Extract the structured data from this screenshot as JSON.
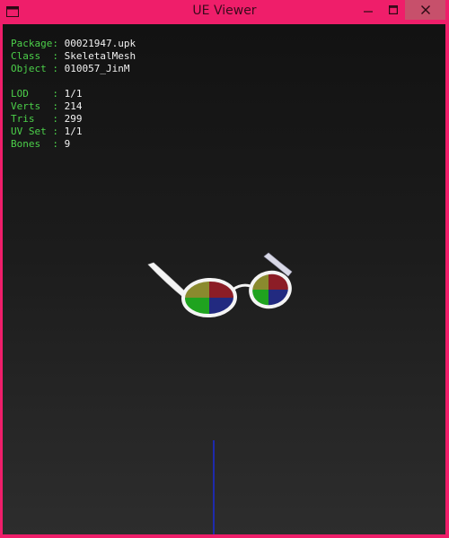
{
  "window": {
    "title": "UE Viewer",
    "minimize_glyph": "—",
    "maximize_glyph": "☐",
    "close_glyph": "✕"
  },
  "info": {
    "group1": [
      {
        "label": "Package:",
        "value": "00021947.upk"
      },
      {
        "label": "Class  :",
        "value": "SkeletalMesh"
      },
      {
        "label": "Object :",
        "value": "010057_JinM"
      }
    ],
    "group2": [
      {
        "label": "LOD    :",
        "value": "1/1"
      },
      {
        "label": "Verts  :",
        "value": "214"
      },
      {
        "label": "Tris   :",
        "value": "299"
      },
      {
        "label": "UV Set :",
        "value": "1/1"
      },
      {
        "label": "Bones  :",
        "value": "9"
      }
    ]
  },
  "colors": {
    "window_frame": "#ef1e6a",
    "label_text": "#4cd04a",
    "value_text": "#f2f2f2",
    "lens_olive": "#8a8a2e",
    "lens_red": "#8c1d26",
    "lens_green": "#1fa31f",
    "lens_blue": "#222a80",
    "frame_white": "#f4f4f4",
    "axis_blue": "#1a2bd8"
  },
  "icons": {
    "app": "window-app-icon",
    "minimize": "minimize-icon",
    "maximize": "maximize-icon",
    "close": "close-icon"
  }
}
